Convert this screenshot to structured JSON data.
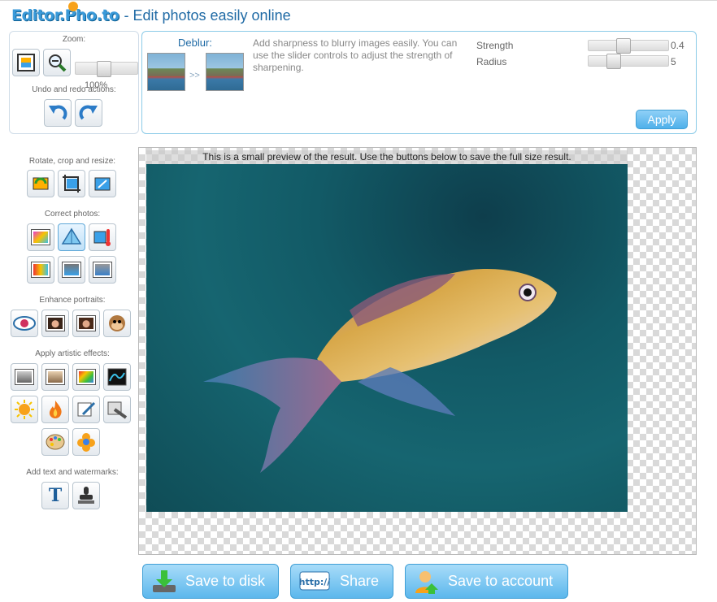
{
  "header": {
    "logo_text": "Editor.Pho.to",
    "tagline": "- Edit photos easily online"
  },
  "left": {
    "zoom_label": "Zoom:",
    "zoom_value": "100%",
    "zoom_level": 0.45,
    "undo_label": "Undo and redo actions:",
    "rotate_label": "Rotate, crop and resize:",
    "correct_label": "Correct photos:",
    "portraits_label": "Enhance portraits:",
    "artistic_label": "Apply artistic effects:",
    "text_label": "Add text and watermarks:"
  },
  "tool_panel": {
    "title": "Deblur:",
    "arrows": ">>",
    "description": "Add sharpness to blurry images easily. You can use the slider controls to adjust the strength of sharpening.",
    "params": [
      {
        "label": "Strength",
        "value": "0.4",
        "level": 0.43
      },
      {
        "label": "Radius",
        "value": "5",
        "level": 0.27
      }
    ],
    "apply_label": "Apply"
  },
  "canvas": {
    "preview_note": "This is a small preview of the result. Use the buttons below to save the full size result."
  },
  "actions": {
    "save_disk": "Save to disk",
    "share": "Share",
    "share_icon_text": "http://",
    "save_account": "Save to account"
  },
  "icons": {
    "fit": "fit-to-screen-icon",
    "zoom": "magnifier-icon",
    "undo": "undo-icon",
    "redo": "redo-icon",
    "text": "T"
  },
  "colors": {
    "accent": "#1f6aa5",
    "button": "#5cb7ec",
    "panel_border": "#8ccbe8"
  }
}
